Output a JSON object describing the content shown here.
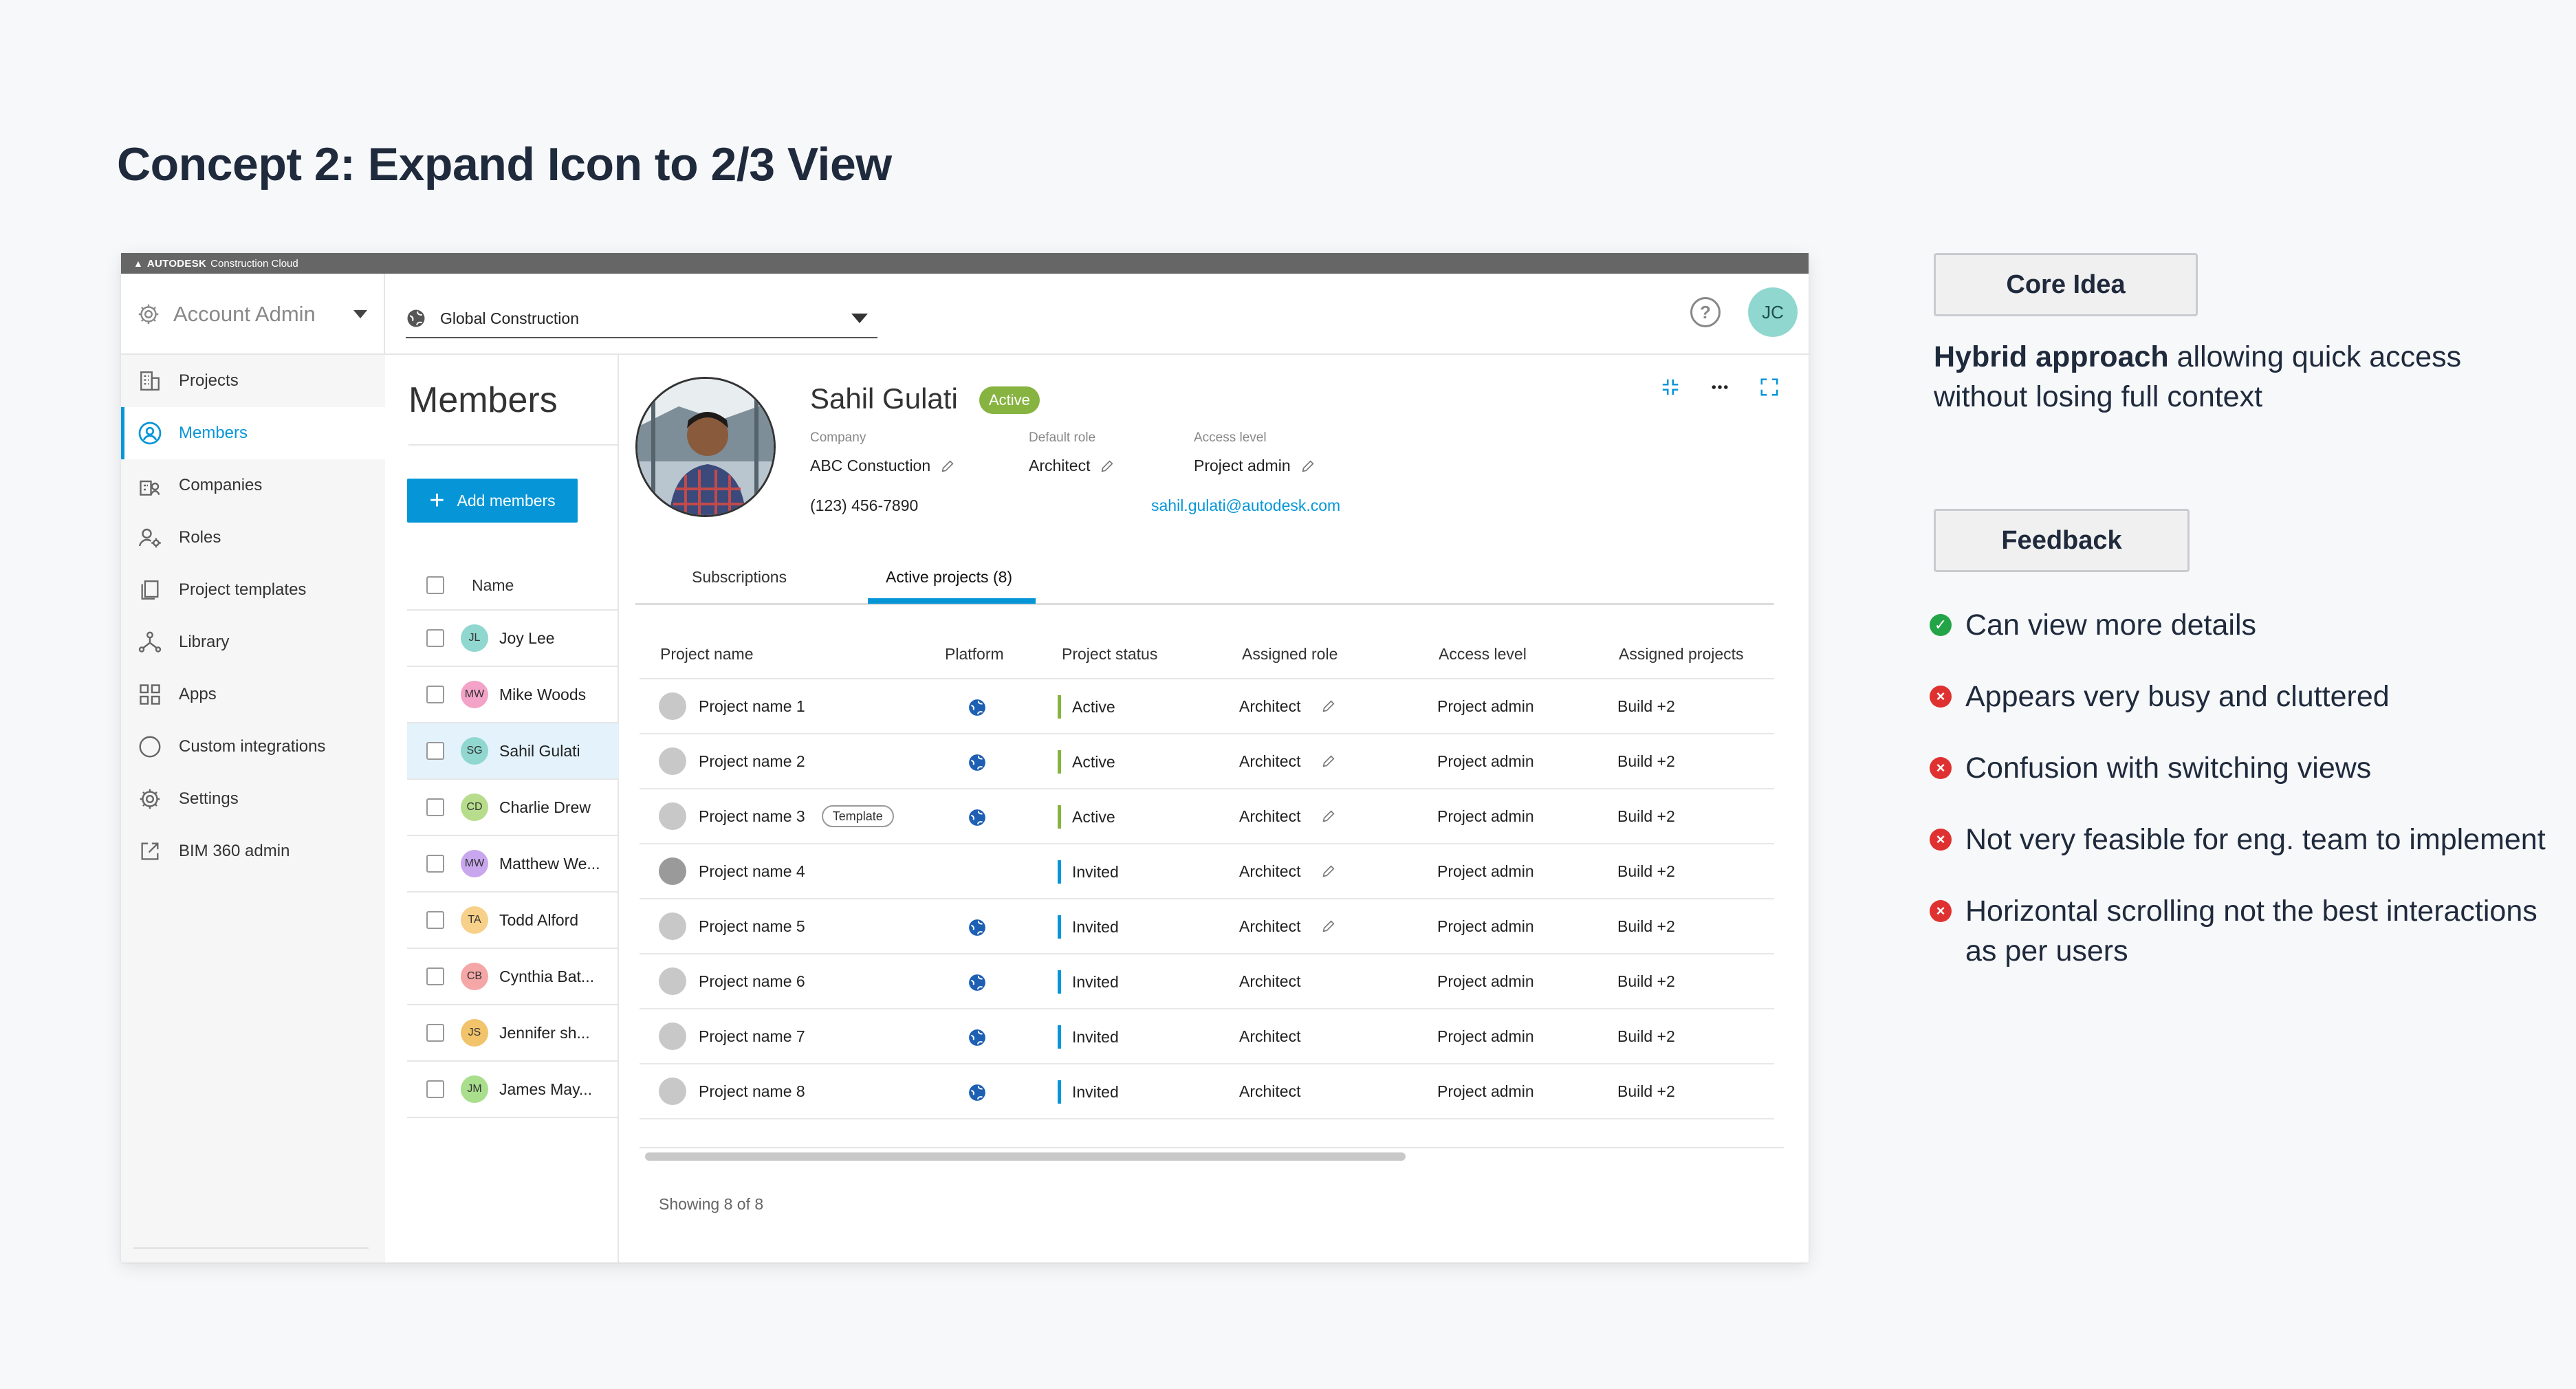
{
  "page_title": "Concept 2: Expand Icon to 2/3 View",
  "app": {
    "brand": "AUTODESK",
    "brand_sub": "Construction Cloud",
    "account_label": "Account Admin",
    "project_selector": "Global Construction",
    "help_symbol": "?",
    "user_initials": "JC"
  },
  "sidebar": {
    "items": [
      {
        "label": "Projects",
        "icon": "building-icon"
      },
      {
        "label": "Members",
        "icon": "person-circle-icon"
      },
      {
        "label": "Companies",
        "icon": "companies-icon"
      },
      {
        "label": "Roles",
        "icon": "user-gear-icon"
      },
      {
        "label": "Project templates",
        "icon": "template-icon"
      },
      {
        "label": "Library",
        "icon": "library-icon"
      },
      {
        "label": "Apps",
        "icon": "apps-grid-icon"
      },
      {
        "label": "Custom integrations",
        "icon": "integration-circle-icon"
      },
      {
        "label": "Settings",
        "icon": "gear-icon"
      },
      {
        "label": "BIM 360 admin",
        "icon": "external-link-icon"
      }
    ],
    "active_index": 1
  },
  "members": {
    "title": "Members",
    "add_button": "Add members",
    "add_symbol": "+",
    "column_name": "Name",
    "rows": [
      {
        "initials": "JL",
        "name": "Joy Lee",
        "color": "#8fd7cf"
      },
      {
        "initials": "MW",
        "name": "Mike Woods",
        "color": "#f4a3c8"
      },
      {
        "initials": "SG",
        "name": "Sahil Gulati",
        "color": "#8fd7cf"
      },
      {
        "initials": "CD",
        "name": "Charlie Drew",
        "color": "#b7dd8c"
      },
      {
        "initials": "MW",
        "name": "Matthew We...",
        "color": "#c9a7ee"
      },
      {
        "initials": "TA",
        "name": "Todd Alford",
        "color": "#f7d089"
      },
      {
        "initials": "CB",
        "name": "Cynthia Bat...",
        "color": "#f5a6a6"
      },
      {
        "initials": "JS",
        "name": "Jennifer sh...",
        "color": "#f1c36b"
      },
      {
        "initials": "JM",
        "name": "James May...",
        "color": "#a9de8c"
      }
    ],
    "selected_index": 2
  },
  "profile": {
    "name": "Sahil Gulati",
    "status": "Active",
    "company_label": "Company",
    "company": "ABC Constuction",
    "role_label": "Default role",
    "role": "Architect",
    "access_label": "Access level",
    "access": "Project admin",
    "phone": "(123) 456-7890",
    "email": "sahil.gulati@autodesk.com"
  },
  "tabs": [
    "Subscriptions",
    "Active projects (8)"
  ],
  "projects_table": {
    "columns": [
      "Project name",
      "Platform",
      "Project status",
      "Assigned role",
      "Access level",
      "Assigned projects"
    ],
    "rows": [
      {
        "name": "Project name 1",
        "badge": "",
        "platform": true,
        "status": "Active",
        "role": "Architect",
        "editable": true,
        "access": "Project admin",
        "projects": "Build +2"
      },
      {
        "name": "Project name 2",
        "badge": "",
        "platform": true,
        "status": "Active",
        "role": "Architect",
        "editable": true,
        "access": "Project admin",
        "projects": "Build +2"
      },
      {
        "name": "Project name 3",
        "badge": "Template",
        "platform": true,
        "status": "Active",
        "role": "Architect",
        "editable": true,
        "access": "Project admin",
        "projects": "Build +2"
      },
      {
        "name": "Project name 4",
        "badge": "",
        "platform": false,
        "status": "Invited",
        "role": "Architect",
        "editable": true,
        "access": "Project admin",
        "projects": "Build +2"
      },
      {
        "name": "Project name 5",
        "badge": "",
        "platform": true,
        "status": "Invited",
        "role": "Architect",
        "editable": true,
        "access": "Project admin",
        "projects": "Build +2"
      },
      {
        "name": "Project name 6",
        "badge": "",
        "platform": true,
        "status": "Invited",
        "role": "Architect",
        "editable": false,
        "access": "Project admin",
        "projects": "Build +2"
      },
      {
        "name": "Project name 7",
        "badge": "",
        "platform": true,
        "status": "Invited",
        "role": "Architect",
        "editable": false,
        "access": "Project admin",
        "projects": "Build +2"
      },
      {
        "name": "Project name 8",
        "badge": "",
        "platform": true,
        "status": "Invited",
        "role": "Architect",
        "editable": false,
        "access": "Project admin",
        "projects": "Build +2"
      }
    ],
    "status_colors": {
      "Active": "#87b340",
      "Invited": "#0696d7"
    },
    "footer": "Showing 8 of 8"
  },
  "core_idea": {
    "title": "Core Idea",
    "bold": "Hybrid approach",
    "rest": " allowing quick access without losing full context"
  },
  "feedback": {
    "title": "Feedback",
    "items": [
      {
        "kind": "positive",
        "text": "Can view more details"
      },
      {
        "kind": "negative",
        "text": "Appears very busy and cluttered"
      },
      {
        "kind": "negative",
        "text": "Confusion with switching views"
      },
      {
        "kind": "negative",
        "text": "Not very feasible for eng. team to implement"
      },
      {
        "kind": "negative",
        "text": "Horizontal scrolling not the best interactions as per users"
      }
    ]
  }
}
